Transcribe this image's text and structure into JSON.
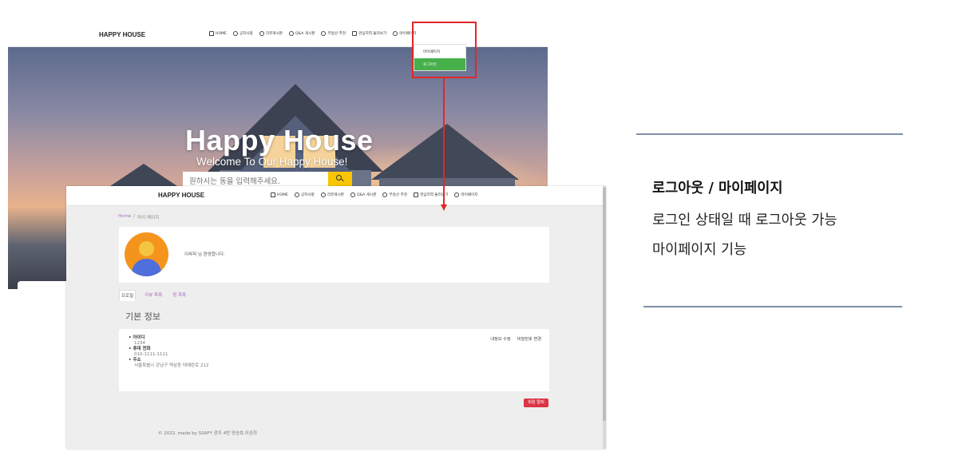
{
  "brand": "HAPPY HOUSE",
  "nav_items": [
    {
      "label": "HOME",
      "icon": "home-icon"
    },
    {
      "label": "공지사항",
      "icon": "info-circle-icon"
    },
    {
      "label": "리뷰게시판",
      "icon": "chat-icon"
    },
    {
      "label": "Q&A 게시판",
      "icon": "question-circle-icon"
    },
    {
      "label": "부동산 추천",
      "icon": "coin-icon"
    },
    {
      "label": "관심지역 둘러보기",
      "icon": "bookmark-icon"
    },
    {
      "label": "마이페이지",
      "icon": "user-circle-icon"
    }
  ],
  "dropdown": {
    "items": [
      "마이페이지",
      "로그아웃"
    ],
    "active_index": 1,
    "active_color": "#46b04a"
  },
  "hero": {
    "title": "Happy House",
    "subtitle": "Welcome To Our Happy House!",
    "search_placeholder": "원하시는 동을 입력해주세요."
  },
  "mypage": {
    "breadcrumb": [
      "Home",
      "/",
      "마이 페이지"
    ],
    "welcome": "이싸피  님 환영합니다.",
    "tabs": [
      "프로필",
      "리뷰 목록",
      "찜 목록"
    ],
    "active_tab": 0,
    "section_title": "기본 정보",
    "fields": [
      {
        "label": "아이디",
        "value": "1234"
      },
      {
        "label": "휴대 전화",
        "value": "010-1111-1111"
      },
      {
        "label": "주소",
        "value": "서울특별시 강남구 역삼동 테헤란로 212"
      }
    ],
    "actions": [
      "내정보 수정",
      "비밀번호 변경"
    ],
    "withdraw": "회원 탈퇴",
    "footer": "© 2022, made by SSAFY 광주 4반 양승호,이승희"
  },
  "description": {
    "title": "로그아웃 / 마이페이지",
    "lines": [
      "로그인 상태일 때 로그아웃 가능",
      "마이페이지 기능"
    ]
  },
  "colors": {
    "highlight": "#e3262a",
    "accent_purple": "#a86cc1",
    "search_button": "#f7c600",
    "danger": "#dc3545",
    "rule": "#7f8fa6"
  }
}
